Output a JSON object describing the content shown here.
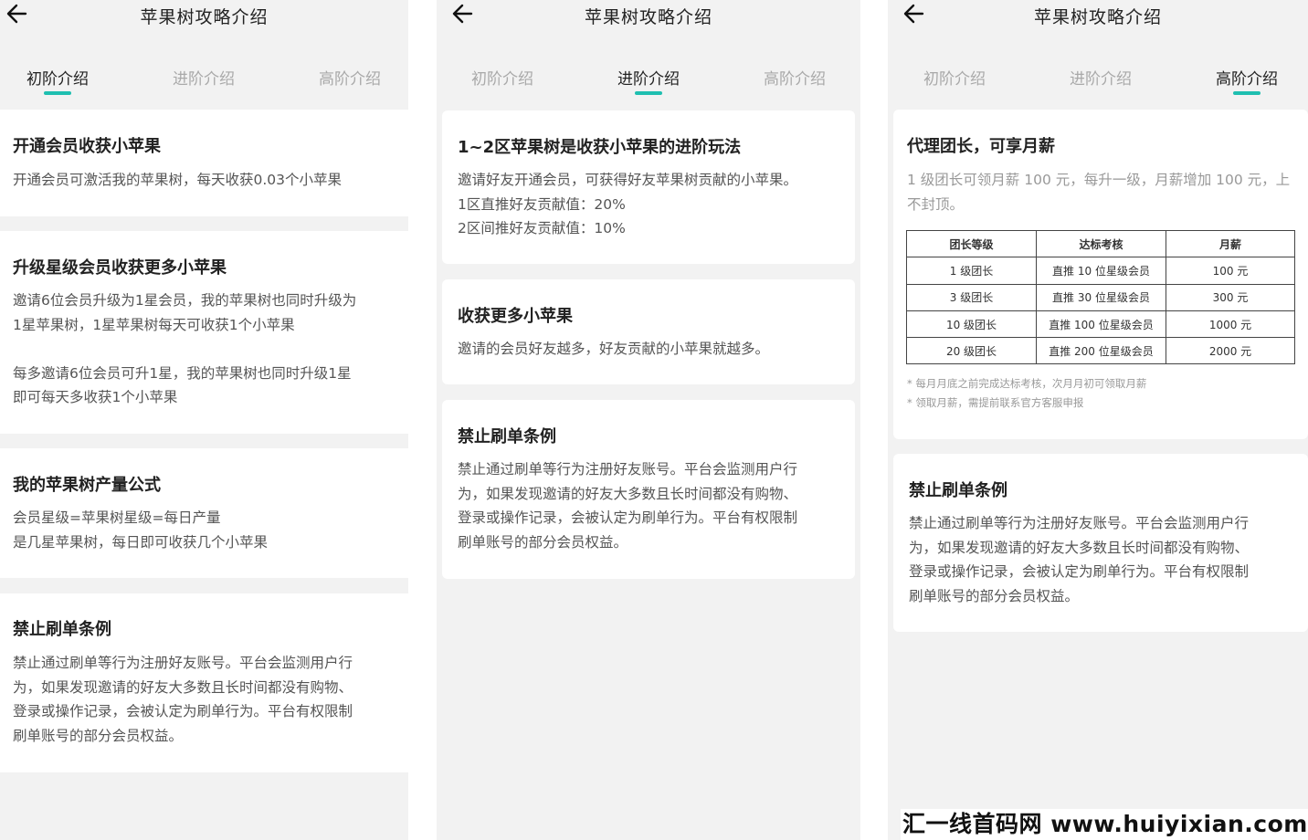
{
  "page_title": "苹果树攻略介绍",
  "tabs": [
    "初阶介绍",
    "进阶介绍",
    "高阶介绍"
  ],
  "accent_color": "#1fbfb0",
  "back_icon": "arrow-left-icon",
  "p1": {
    "active_tab": "初阶介绍",
    "cards": [
      {
        "title": "开通会员收获小苹果",
        "lines": [
          "开通会员可激活我的苹果树，每天收获0.03个小苹果"
        ]
      },
      {
        "title": "升级星级会员收获更多小苹果",
        "lines": [
          "邀请6位会员升级为1星会员，我的苹果树也同时升级为",
          "1星苹果树，1星苹果树每天可收获1个小苹果",
          "",
          "每多邀请6位会员可升1星，我的苹果树也同时升级1星",
          "即可每天多收获1个小苹果"
        ]
      },
      {
        "title": "我的苹果树产量公式",
        "lines": [
          "会员星级=苹果树星级=每日产量",
          "是几星苹果树，每日即可收获几个小苹果"
        ]
      },
      {
        "title": "禁止刷单条例",
        "lines": [
          "禁止通过刷单等行为注册好友账号。平台会监测用户行",
          "为，如果发现邀请的好友大多数且长时间都没有购物、",
          "登录或操作记录，会被认定为刷单行为。平台有权限制",
          "刷单账号的部分会员权益。"
        ]
      }
    ]
  },
  "p2": {
    "active_tab": "进阶介绍",
    "cards": [
      {
        "title": "1~2区苹果树是收获小苹果的进阶玩法",
        "lines": [
          "邀请好友开通会员，可获得好友苹果树贡献的小苹果。",
          "1区直推好友贡献值：20%",
          "2区间推好友贡献值：10%"
        ]
      },
      {
        "title": "收获更多小苹果",
        "lines": [
          "邀请的会员好友越多，好友贡献的小苹果就越多。"
        ]
      },
      {
        "title": "禁止刷单条例",
        "lines": [
          "禁止通过刷单等行为注册好友账号。平台会监测用户行",
          "为，如果发现邀请的好友大多数且长时间都没有购物、",
          "登录或操作记录，会被认定为刷单行为。平台有权限制",
          "刷单账号的部分会员权益。"
        ]
      }
    ]
  },
  "p3": {
    "active_tab": "高阶介绍",
    "card1": {
      "title": "代理团长，可享月薪",
      "lines": [
        "1 级团长可领月薪 100 元，每升一级，月薪增加 100 元，上",
        "不封顶。"
      ],
      "table_headers": [
        "团长等级",
        "达标考核",
        "月薪"
      ],
      "table_rows": [
        [
          "1 级团长",
          "直推 10 位星级会员",
          "100 元"
        ],
        [
          "3 级团长",
          "直推 30 位星级会员",
          "300 元"
        ],
        [
          "10 级团长",
          "直推 100 位星级会员",
          "1000 元"
        ],
        [
          "20 级团长",
          "直推 200 位星级会员",
          "2000 元"
        ]
      ],
      "notes": [
        "* 每月月底之前完成达标考核，次月月初可领取月薪",
        "* 领取月薪，需提前联系官方客服申报"
      ]
    },
    "card2": {
      "title": "禁止刷单条例",
      "lines": [
        "禁止通过刷单等行为注册好友账号。平台会监测用户行",
        "为，如果发现邀请的好友大多数且长时间都没有购物、",
        "登录或操作记录，会被认定为刷单行为。平台有权限制",
        "刷单账号的部分会员权益。"
      ]
    }
  },
  "watermark": "汇一线首码网 www.huiyixian.com"
}
